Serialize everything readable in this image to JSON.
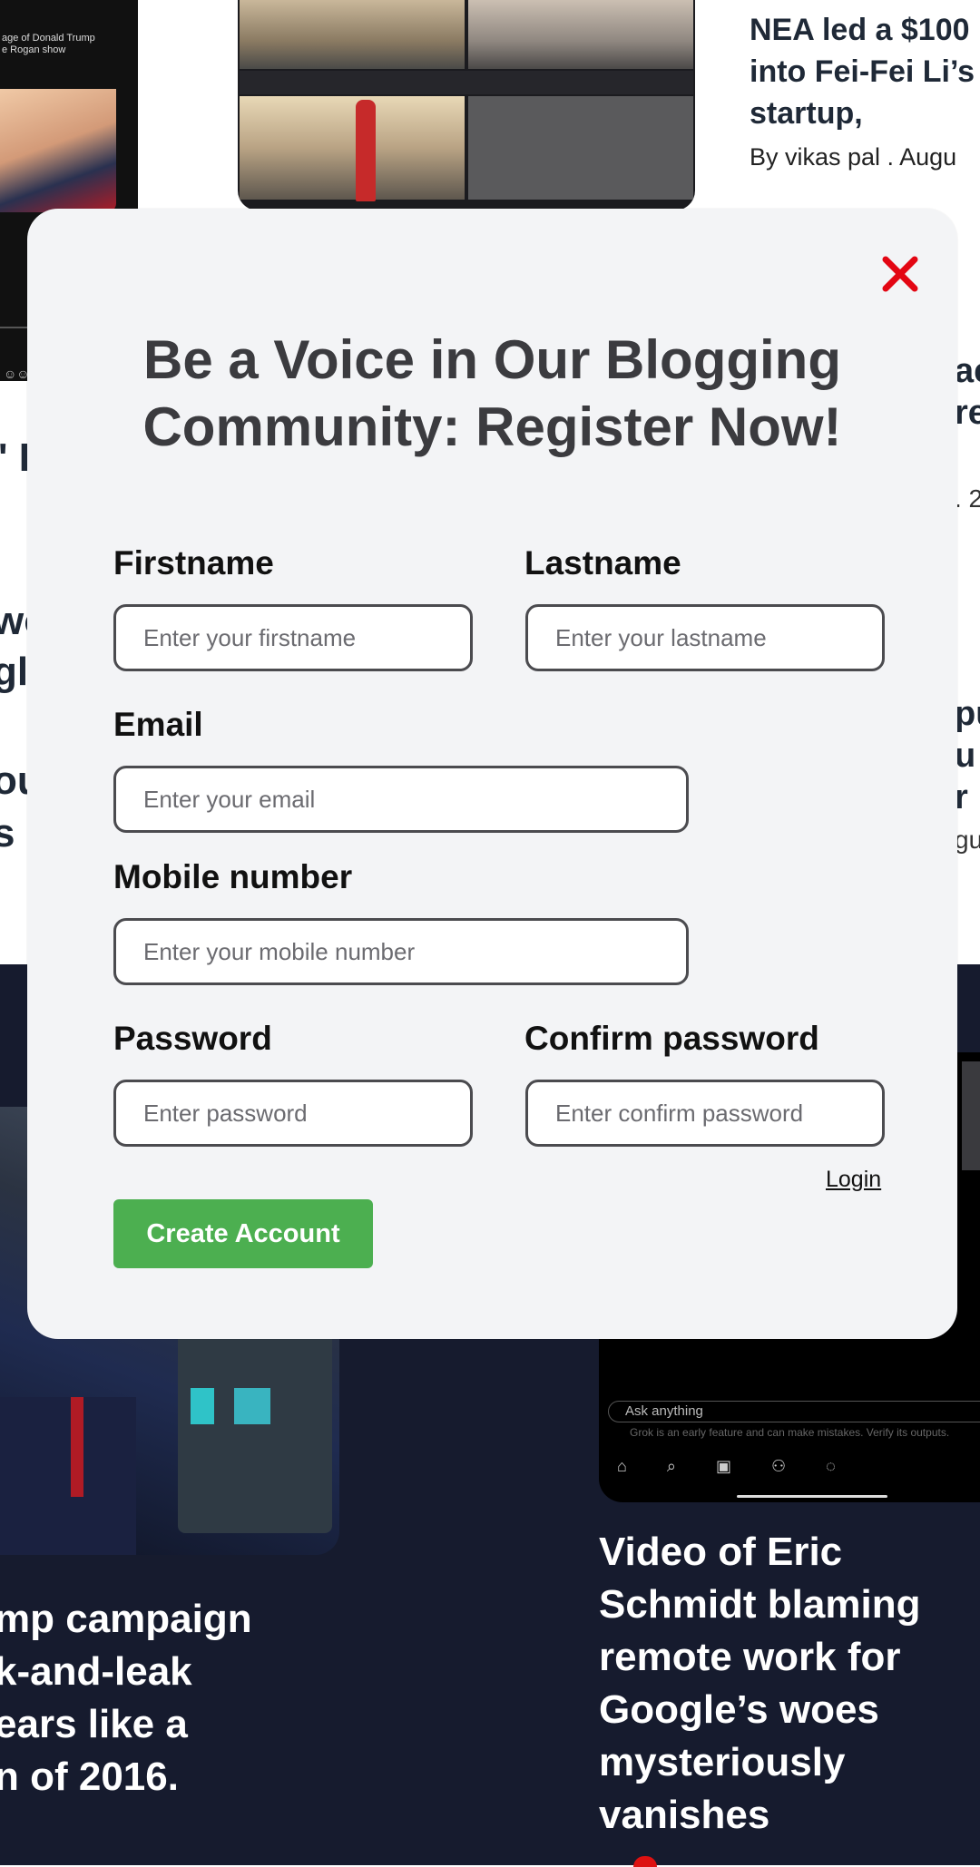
{
  "background": {
    "left_thumb_caption": "age of Donald Trump\ne Rogan show",
    "right_article": {
      "title": "NEA led a $100\ninto Fei-Fei Li’s\nstartup,",
      "byline": "By vikas pal . Augu"
    },
    "fragments_left": [
      "' E",
      "wo",
      "gle",
      "ou",
      "s"
    ],
    "fragments_right": [
      "ac",
      "re",
      ". 2",
      "pu",
      "u",
      "r",
      "gu"
    ],
    "grok_ui": {
      "ask_placeholder": "Ask anything",
      "note": "Grok is an early feature and can make mistakes. Verify its outputs."
    },
    "dark_left_title": "mp campaign\nk-and-leak\nears like a\nn of 2016.",
    "dark_right_title": "Video of Eric Schmidt blaming remote work for Google’s woes mysteriously vanishes"
  },
  "modal": {
    "title": "Be a Voice in Our Blogging Community: Register Now!",
    "close_color": "#e30613",
    "fields": {
      "firstname": {
        "label": "Firstname",
        "placeholder": "Enter your firstname",
        "value": ""
      },
      "lastname": {
        "label": "Lastname",
        "placeholder": "Enter your lastname",
        "value": ""
      },
      "email": {
        "label": "Email",
        "placeholder": "Enter your email",
        "value": ""
      },
      "mobile": {
        "label": "Mobile number",
        "placeholder": "Enter your mobile number",
        "value": ""
      },
      "password": {
        "label": "Password",
        "placeholder": "Enter password",
        "value": ""
      },
      "confirm_password": {
        "label": "Confirm password",
        "placeholder": "Enter confirm password",
        "value": ""
      }
    },
    "login_link": "Login",
    "create_button": "Create Account",
    "create_button_color": "#4caf50"
  }
}
